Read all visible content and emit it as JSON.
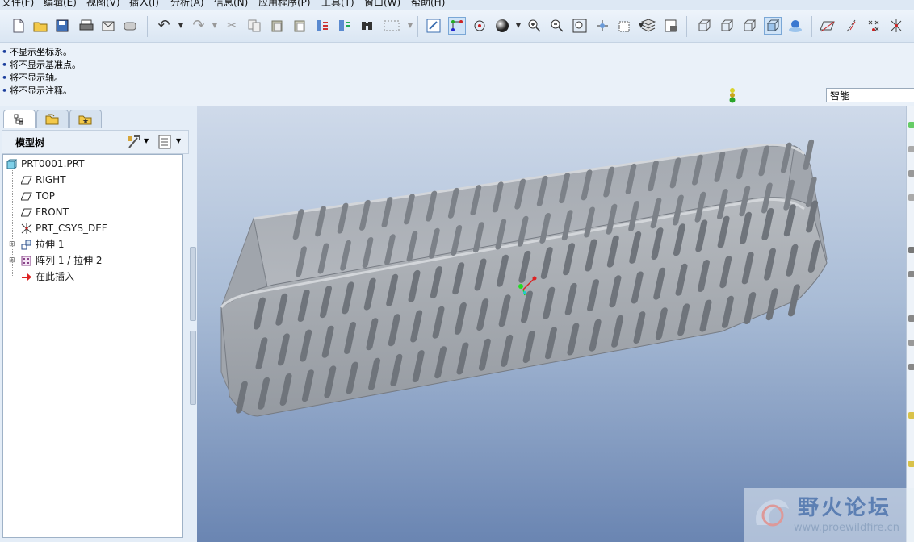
{
  "menu": {
    "items": [
      "文件(F)",
      "编辑(E)",
      "视图(V)",
      "插入(I)",
      "分析(A)",
      "信息(N)",
      "应用程序(P)",
      "工具(T)",
      "窗口(W)",
      "帮助(H)"
    ]
  },
  "toolbar": {
    "icons": [
      "new-file-icon",
      "open-folder-icon",
      "save-icon",
      "print-icon",
      "send-mail-icon",
      "erase-icon",
      "undo-icon",
      "redo-icon",
      "cut-icon",
      "copy-icon",
      "paste-icon",
      "paste-special-icon",
      "regenerate-icon",
      "regen-manager-icon",
      "find-icon",
      "select-box-icon",
      "repaint-icon",
      "spin-center-icon",
      "orient-icon",
      "shading-icon",
      "zoom-in-icon",
      "zoom-out-icon",
      "refit-icon",
      "saved-views-icon",
      "view-manager-icon",
      "layers-icon",
      "model-display-icon",
      "wireframe-icon",
      "hidden-line-icon",
      "no-hidden-icon",
      "shaded-icon",
      "enhanced-realism-icon",
      "datum-planes-icon",
      "datum-axes-icon",
      "datum-points-icon",
      "csys-icon"
    ]
  },
  "messages": [
    "不显示坐标系。",
    "将不显示基准点。",
    "将不显示轴。",
    "将不显示注释。"
  ],
  "filter": {
    "value": "智能"
  },
  "panel_tabs": [
    "model-tree-tab",
    "folder-browser-tab",
    "favorites-tab"
  ],
  "model_tree": {
    "title": "模型树",
    "root": "PRT0001.PRT",
    "items": [
      {
        "label": "RIGHT",
        "icon": "datum-plane-icon"
      },
      {
        "label": "TOP",
        "icon": "datum-plane-icon"
      },
      {
        "label": "FRONT",
        "icon": "datum-plane-icon"
      },
      {
        "label": "PRT_CSYS_DEF",
        "icon": "csys-icon"
      },
      {
        "label": "拉伸 1",
        "icon": "extrude-icon"
      },
      {
        "label": "阵列 1 / 拉伸 2",
        "icon": "pattern-icon"
      },
      {
        "label": "在此插入",
        "icon": "insert-here-arrow-icon"
      }
    ]
  },
  "watermark": {
    "title": "野火论坛",
    "url": "www.proewildfire.cn"
  },
  "colors": {
    "accent": "#4a78b8",
    "viewport_top": "#cfdaea",
    "viewport_bottom": "#6a85b2",
    "part": "#a9adb4"
  }
}
